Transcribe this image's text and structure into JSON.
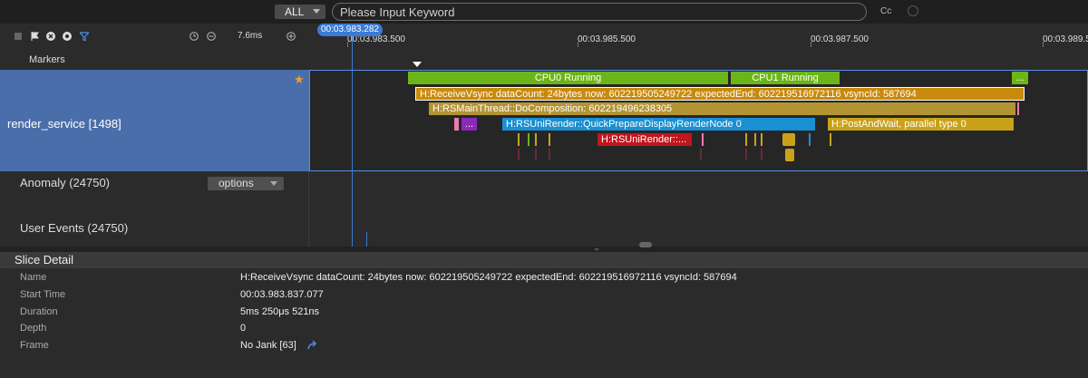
{
  "search": {
    "filter_value": "ALL",
    "placeholder": "Please Input Keyword",
    "case_toggle": "Cc"
  },
  "toolbar": {
    "zoom_value": "7.6ms"
  },
  "timeline": {
    "cursor_time": "00:03.983.282",
    "ticks": [
      "00:03.983.500",
      "00:03.985.500",
      "00:03.987.500",
      "00:03.989.5"
    ]
  },
  "markers": {
    "label": "Markers"
  },
  "process": {
    "label": "render_service [1498]",
    "slices": {
      "cpu0": "CPU0 Running",
      "cpu1": "CPU1 Running",
      "cpu_more": "...",
      "vsync": "H:ReceiveVsync dataCount: 24bytes now: 602219505249722 expectedEnd: 602219516972116 vsyncId: 587694",
      "composition": "H:RSMainThread::DoComposition: 602219496238305",
      "prepare": "H:RSUniRender::QuickPrepareDisplayRenderNode 0",
      "post_wait": "H:PostAndWait, parallel type 0",
      "purple_more": "...",
      "uni_render": "H:RSUniRender::..."
    }
  },
  "anomaly": {
    "label": "Anomaly (24750)",
    "options_label": "options"
  },
  "user_events": {
    "label": "User Events (24750)"
  },
  "slice_detail": {
    "title": "Slice Detail",
    "rows": [
      {
        "key": "Name",
        "value": "H:ReceiveVsync dataCount: 24bytes now: 602219505249722 expectedEnd: 602219516972116 vsyncId: 587694"
      },
      {
        "key": "Start Time",
        "value": "00:03.983.837.077"
      },
      {
        "key": "Duration",
        "value": "5ms 250μs 521ns"
      },
      {
        "key": "Depth",
        "value": "0"
      },
      {
        "key": "Frame",
        "value": "No Jank [63]"
      }
    ]
  },
  "colors": {
    "cpu_green": "#6cb519",
    "vsync_orange": "#c98a0c",
    "composition_gold": "#b39433",
    "prepare_blue": "#1a8fd1",
    "postwait_yellow": "#c9a21a",
    "uni_red": "#c0161d",
    "selection_blue": "#4a6ea9",
    "cursor_blue": "#3a7bd5"
  },
  "icons": [
    "checkbox-icon",
    "flag-icon",
    "circle-cross-icon",
    "target-icon",
    "filter-icon",
    "clock-icon",
    "zoom-out-icon",
    "zoom-in-icon",
    "star-icon",
    "jump-link-icon"
  ]
}
